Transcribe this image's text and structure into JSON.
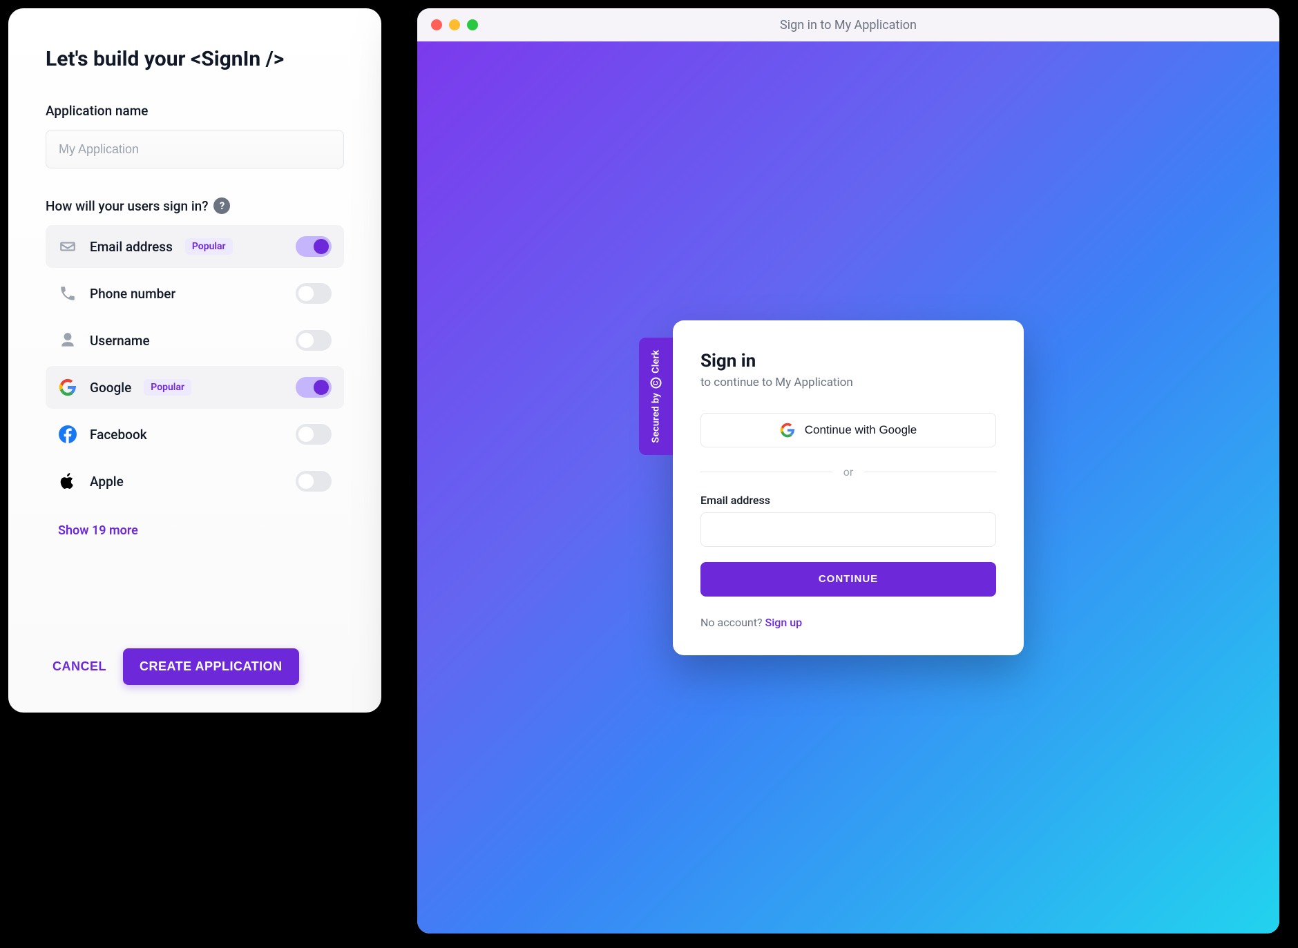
{
  "builder": {
    "title": "Let's build your <SignIn />",
    "app_name_label": "Application name",
    "app_name_placeholder": "My Application",
    "signin_question": "How will your users sign in?",
    "options": [
      {
        "key": "email",
        "label": "Email address",
        "popular": true,
        "enabled": true
      },
      {
        "key": "phone",
        "label": "Phone number",
        "popular": false,
        "enabled": false
      },
      {
        "key": "username",
        "label": "Username",
        "popular": false,
        "enabled": false
      },
      {
        "key": "google",
        "label": "Google",
        "popular": true,
        "enabled": true
      },
      {
        "key": "facebook",
        "label": "Facebook",
        "popular": false,
        "enabled": false
      },
      {
        "key": "apple",
        "label": "Apple",
        "popular": false,
        "enabled": false
      }
    ],
    "popular_badge": "Popular",
    "show_more": "Show 19 more",
    "cancel": "CANCEL",
    "create": "CREATE APPLICATION"
  },
  "preview": {
    "window_title": "Sign in to My Application",
    "secured_by": "Secured by",
    "brand": "Clerk",
    "login": {
      "title": "Sign in",
      "subtitle": "to continue to My Application",
      "google_label": "Continue with Google",
      "or": "or",
      "email_label": "Email address",
      "continue": "CONTINUE",
      "no_account": "No account? ",
      "signup": "Sign up"
    }
  }
}
